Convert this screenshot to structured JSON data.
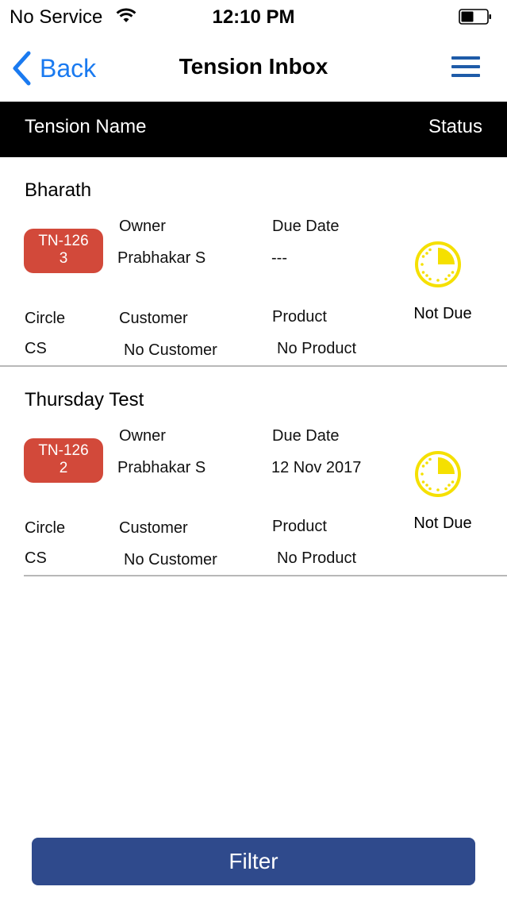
{
  "status_bar": {
    "carrier": "No Service",
    "time": "12:10 PM"
  },
  "nav": {
    "back_label": "Back",
    "title": "Tension Inbox"
  },
  "table_header": {
    "name_col": "Tension Name",
    "status_col": "Status"
  },
  "labels": {
    "owner": "Owner",
    "due_date": "Due Date",
    "circle": "Circle",
    "customer": "Customer",
    "product": "Product"
  },
  "tensions": [
    {
      "name": "Bharath",
      "id_line1": "TN-126",
      "id_line2": "3",
      "owner": "Prabhakar S",
      "due_date": "---",
      "circle": "CS",
      "customer": "No Customer",
      "product": "No Product",
      "status": "Not Due"
    },
    {
      "name": "Thursday Test",
      "id_line1": "TN-126",
      "id_line2": "2",
      "owner": "Prabhakar S",
      "due_date": "12 Nov 2017",
      "circle": "CS",
      "customer": "No Customer",
      "product": "No Product",
      "status": "Not Due"
    }
  ],
  "filter_label": "Filter",
  "colors": {
    "accent_blue": "#1a7af0",
    "menu_blue": "#1e5ba8",
    "badge_red": "#d2493a",
    "status_yellow": "#f5e000",
    "filter_blue": "#2f4a8c"
  },
  "icons": {
    "wifi": "wifi-icon",
    "battery": "battery-icon",
    "back": "chevron-left-icon",
    "menu": "hamburger-menu-icon",
    "status": "clock-pie-icon"
  }
}
